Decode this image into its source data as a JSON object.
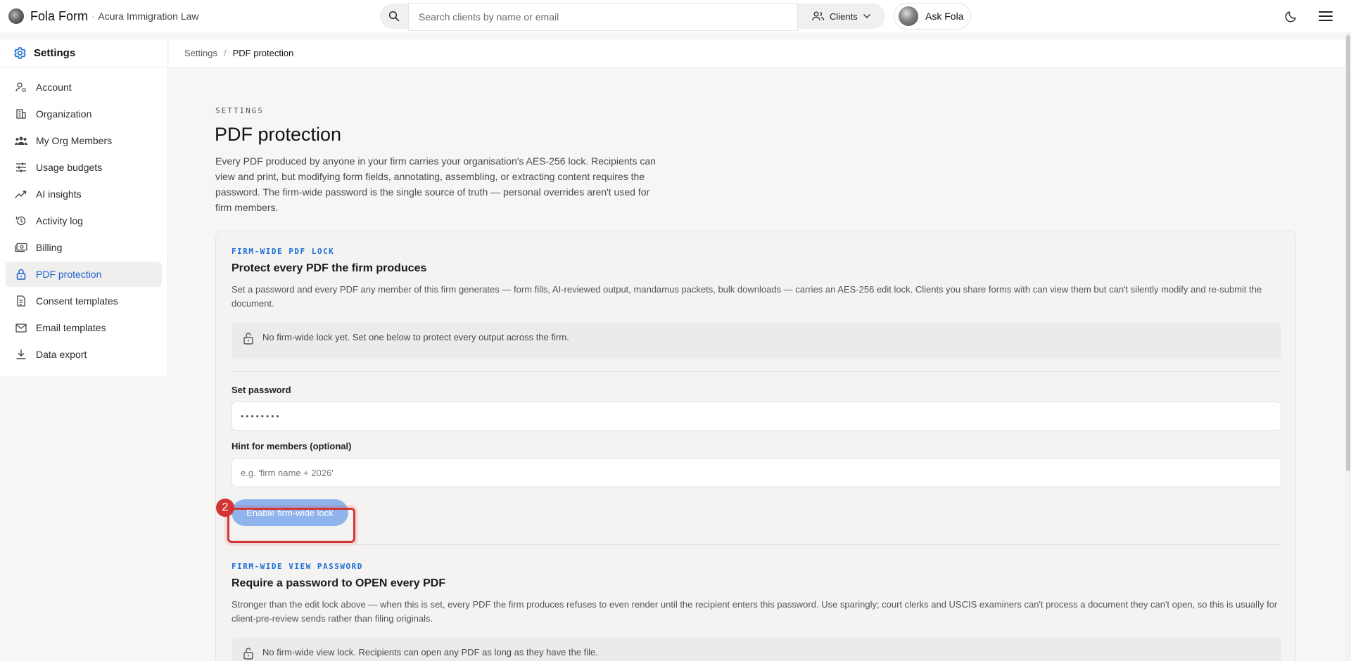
{
  "topbar": {
    "brand_name": "Fola Form",
    "brand_separator": "·",
    "firm_name": "Acura Immigration Law",
    "search_placeholder": "Search clients by name or email",
    "clients_label": "Clients",
    "ask_label": "Ask Fola"
  },
  "sidebar": {
    "title": "Settings",
    "items": [
      {
        "label": "Account",
        "icon": "account-icon"
      },
      {
        "label": "Organization",
        "icon": "building-icon"
      },
      {
        "label": "My Org Members",
        "icon": "members-icon"
      },
      {
        "label": "Usage budgets",
        "icon": "sliders-icon"
      },
      {
        "label": "AI insights",
        "icon": "trend-icon"
      },
      {
        "label": "Activity log",
        "icon": "history-icon"
      },
      {
        "label": "Billing",
        "icon": "billing-icon"
      },
      {
        "label": "PDF protection",
        "icon": "lock-icon",
        "active": true
      },
      {
        "label": "Consent templates",
        "icon": "document-icon"
      },
      {
        "label": "Email templates",
        "icon": "mail-icon"
      },
      {
        "label": "Data export",
        "icon": "download-icon"
      }
    ]
  },
  "breadcrumb": {
    "root": "Settings",
    "separator": "/",
    "current": "PDF protection"
  },
  "page": {
    "eyebrow": "SETTINGS",
    "title": "PDF protection",
    "description": "Every PDF produced by anyone in your firm carries your organisation's AES-256 lock. Recipients can view and print, but modifying form fields, annotating, assembling, or extracting content requires the password. The firm-wide password is the single source of truth — personal overrides aren't used for firm members."
  },
  "lock_section": {
    "eyebrow": "FIRM-WIDE PDF LOCK",
    "title": "Protect every PDF the firm produces",
    "description": "Set a password and every PDF any member of this firm generates — form fills, AI-reviewed output, mandamus packets, bulk downloads — carries an AES-256 edit lock. Clients you share forms with can view them but can't silently modify and re-submit the document.",
    "notice": "No firm-wide lock yet. Set one below to protect every output across the firm.",
    "password_label": "Set password",
    "password_value": "••••••••",
    "hint_label": "Hint for members (optional)",
    "hint_placeholder": "e.g. 'firm name + 2026'",
    "enable_label": "Enable firm-wide lock"
  },
  "annotation": {
    "badge": "2",
    "color": "#d33434"
  },
  "view_section": {
    "eyebrow": "FIRM-WIDE VIEW PASSWORD",
    "title": "Require a password to OPEN every PDF",
    "description": "Stronger than the edit lock above — when this is set, every PDF the firm produces refuses to even render until the recipient enters this password. Use sparingly; court clerks and USCIS examiners can't process a document they can't open, so this is usually for client-pre-review sends rather than filing originals.",
    "notice": "No firm-wide view lock. Recipients can open any PDF as long as they have the file."
  },
  "colors": {
    "accent": "#1a6fd8",
    "active_nav": "#1a5fd0",
    "button_disabled": "#8fb3ec"
  }
}
